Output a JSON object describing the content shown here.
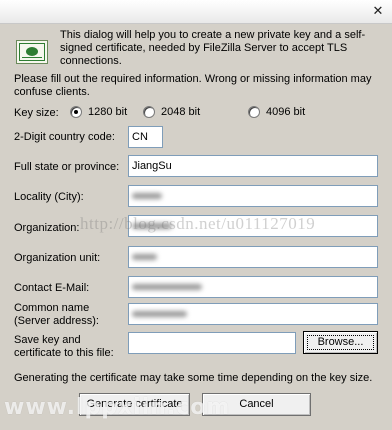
{
  "dialog": {
    "close_glyph": "✕",
    "intro": "This dialog will help you to create a new private key and a self-signed certificate, needed by FileZilla Server to accept TLS connections.",
    "instructions": "Please fill out the required information. Wrong or missing information may confuse clients."
  },
  "key_size": {
    "label": "Key size:",
    "options": [
      "1280 bit",
      "2048 bit",
      "4096 bit"
    ],
    "selected": "1280 bit"
  },
  "fields": {
    "country": {
      "label": "2-Digit country code:",
      "value": "CN"
    },
    "state": {
      "label": "Full state or province:",
      "value": "JiangSu"
    },
    "locality": {
      "label": "Locality (City):",
      "value": ""
    },
    "organization": {
      "label": "Organization:",
      "value": ""
    },
    "org_unit": {
      "label": "Organization unit:",
      "value": ""
    },
    "email": {
      "label": "Contact E-Mail:",
      "value": ""
    },
    "common_name": {
      "label_line1": "Common name",
      "label_line2": "(Server address):",
      "value": ""
    },
    "save_path": {
      "label_line1": "Save key and",
      "label_line2": "certificate to this file:",
      "value": ""
    }
  },
  "buttons": {
    "browse": "Browse...",
    "generate": "Generate certificate",
    "cancel": "Cancel"
  },
  "note": "Generating the certificate may take some time depending on the key size.",
  "overlays": {
    "watermark": "http://blog.csdn.net/u011127019",
    "brand": "www.lppxiin.com"
  }
}
